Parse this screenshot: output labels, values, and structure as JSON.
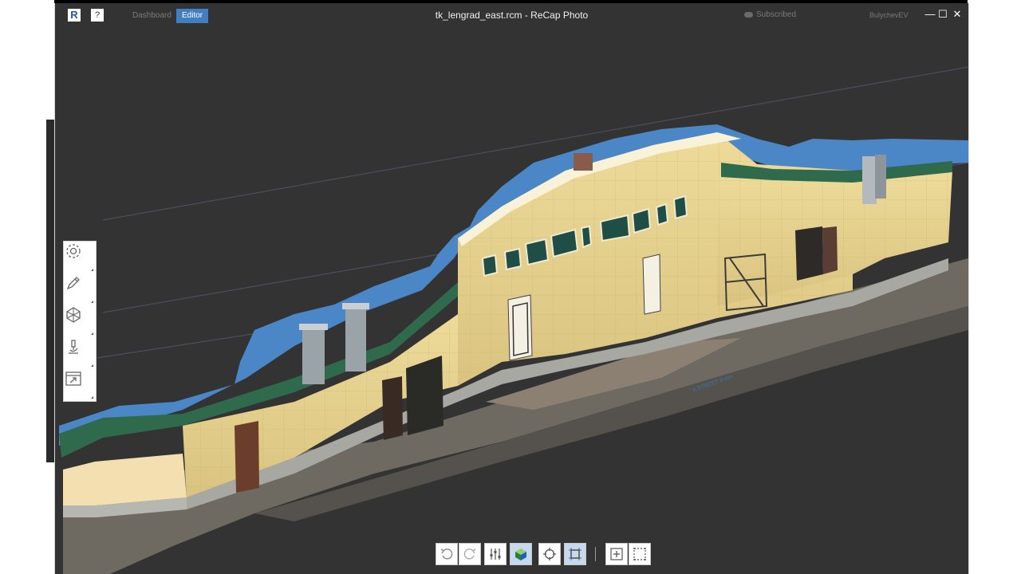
{
  "window": {
    "title": "tk_lengrad_east.rcm - ReCap Photo",
    "logo_letter": "R",
    "help_label": "?",
    "tabs": [
      {
        "label": "Dashboard",
        "active": false
      },
      {
        "label": "Editor",
        "active": true
      }
    ],
    "subscription_status": "Subscribed",
    "username": "BulychevEV",
    "controls": {
      "minimize": "—",
      "maximize": "☐",
      "close": "✕"
    }
  },
  "left_toolbar": {
    "tools": [
      {
        "name": "settings",
        "icon": "gear-icon"
      },
      {
        "name": "edit",
        "icon": "pencil-icon"
      },
      {
        "name": "mesh",
        "icon": "mesh-icon"
      },
      {
        "name": "analyze",
        "icon": "microscope-icon"
      },
      {
        "name": "export",
        "icon": "export-icon"
      }
    ]
  },
  "viewport": {
    "measurement_label": "X STREET 8 mm"
  },
  "bottom_toolbar": {
    "buttons": [
      {
        "name": "undo",
        "icon": "undo-icon",
        "active": false
      },
      {
        "name": "redo",
        "icon": "redo-icon",
        "active": false
      },
      {
        "name": "adjust",
        "icon": "sliders-icon",
        "active": false
      },
      {
        "name": "texture",
        "icon": "cube-icon",
        "active": true
      },
      {
        "name": "orbit-target",
        "icon": "crosshair-icon",
        "active": false
      },
      {
        "name": "select",
        "icon": "select-box-icon",
        "active": true
      },
      {
        "name": "add-selection",
        "icon": "add-box-icon",
        "active": false
      },
      {
        "name": "dashed-selection",
        "icon": "dashed-box-icon",
        "active": false
      }
    ]
  },
  "colors": {
    "background": "#333333",
    "accent": "#3f7fc2",
    "wall": "#e8d38f",
    "roof": "#2f6a4c",
    "sky": "#4b86c6"
  }
}
